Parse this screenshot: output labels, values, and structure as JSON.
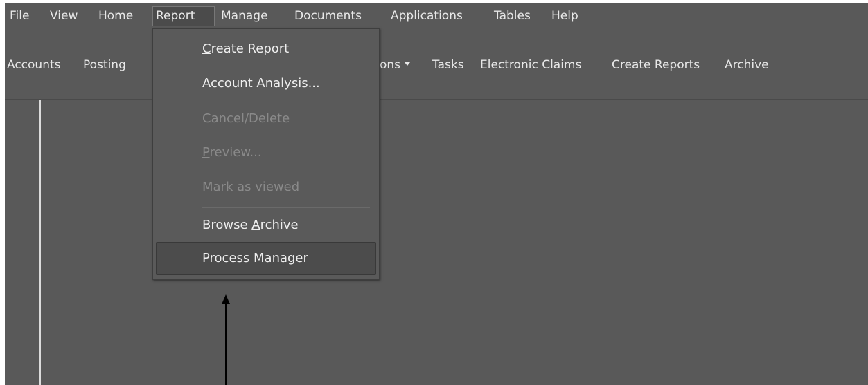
{
  "menubar": {
    "items": [
      {
        "label": "File"
      },
      {
        "label": "View"
      },
      {
        "label": "Home"
      },
      {
        "label": "Report"
      },
      {
        "label": "Manage"
      },
      {
        "label": "Documents"
      },
      {
        "label": "Applications"
      },
      {
        "label": "Tables"
      },
      {
        "label": "Help"
      }
    ]
  },
  "toolbar": {
    "items": [
      {
        "label": "Accounts"
      },
      {
        "label": "Posting"
      },
      {
        "label": "ons"
      },
      {
        "label": "Tasks"
      },
      {
        "label": "Electronic Claims"
      },
      {
        "label": "Create Reports"
      },
      {
        "label": "Archive"
      }
    ]
  },
  "report_menu": {
    "create_report": {
      "pre": "",
      "key": "C",
      "post": "reate Report"
    },
    "account_analysis": {
      "pre": "Acc",
      "key": "o",
      "post": "unt Analysis..."
    },
    "cancel_delete": {
      "label": "Cancel/Delete"
    },
    "preview": {
      "pre": "",
      "key": "P",
      "post": "review..."
    },
    "mark_as_viewed": {
      "label": "Mark as viewed"
    },
    "browse_archive": {
      "pre": "Browse ",
      "key": "A",
      "post": "rchive"
    },
    "process_manager": {
      "label": "Process Manager"
    }
  },
  "colors": {
    "background": "#595959",
    "text": "#e8e8e8",
    "disabled_text": "#8a8a8a",
    "highlight": "#4c4c4c"
  }
}
